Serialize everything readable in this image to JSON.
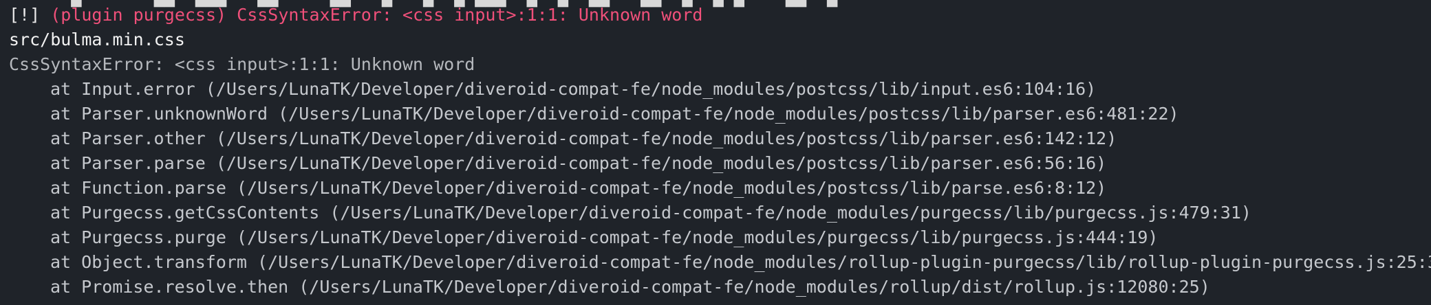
{
  "terminal": {
    "cut_line": "      ▄   ▀   ▄▄  ▄▄▄▀  ▄▄ ▀  ▀▄▄   ▄  ▀▄  ▄▀▄▄▄  ▄▀ ▄ ▀▄▄▀  ▄▄ ▀▄ ▀▄ ▄   ▀▄▄  ▄  ▀",
    "error_tag": "[!]",
    "error_message": "(plugin purgecss) CssSyntaxError: <css input>:1:1: Unknown word",
    "file": "src/bulma.min.css",
    "error_detail": "CssSyntaxError: <css input>:1:1: Unknown word",
    "stack_trace": [
      "at Input.error (/Users/LunaTK/Developer/diveroid-compat-fe/node_modules/postcss/lib/input.es6:104:16)",
      "at Parser.unknownWord (/Users/LunaTK/Developer/diveroid-compat-fe/node_modules/postcss/lib/parser.es6:481:22)",
      "at Parser.other (/Users/LunaTK/Developer/diveroid-compat-fe/node_modules/postcss/lib/parser.es6:142:12)",
      "at Parser.parse (/Users/LunaTK/Developer/diveroid-compat-fe/node_modules/postcss/lib/parser.es6:56:16)",
      "at Function.parse (/Users/LunaTK/Developer/diveroid-compat-fe/node_modules/postcss/lib/parse.es6:8:12)",
      "at Purgecss.getCssContents (/Users/LunaTK/Developer/diveroid-compat-fe/node_modules/purgecss/lib/purgecss.js:479:31)",
      "at Purgecss.purge (/Users/LunaTK/Developer/diveroid-compat-fe/node_modules/purgecss/lib/purgecss.js:444:19)",
      "at Object.transform (/Users/LunaTK/Developer/diveroid-compat-fe/node_modules/rollup-plugin-purgecss/lib/rollup-plugin-purgecss.js:25:3",
      "at Promise.resolve.then (/Users/LunaTK/Developer/diveroid-compat-fe/node_modules/rollup/dist/rollup.js:12080:25)"
    ]
  }
}
